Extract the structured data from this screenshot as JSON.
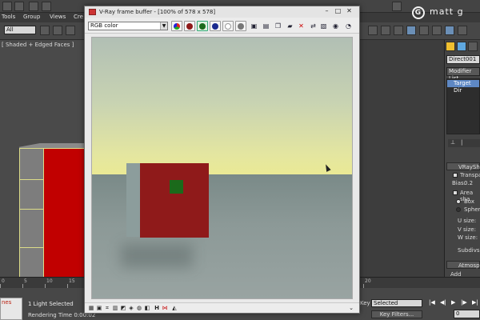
{
  "menubar": {
    "tools": "Tools",
    "group": "Group",
    "views": "Views",
    "create_partial": "Cre"
  },
  "toolbar": {
    "selection_filter": "All"
  },
  "viewport": {
    "label": "[ Shaded + Edged Faces ]"
  },
  "logo": {
    "text": "matt g",
    "mark": "G"
  },
  "command_panel": {
    "object_name": "Direct001",
    "modifier_list": "Modifier List",
    "stack_item": "Target Dir",
    "rollout_title": "VRayShac",
    "transparent_label": "Transpar",
    "bias_label": "Bias:",
    "bias_value": "0.2",
    "area_shadow_label": "Area sha",
    "box_label": "Box",
    "sphere_label": "Sphere",
    "usize_label": "U size:",
    "vsize_label": "V size:",
    "wsize_label": "W size:",
    "subdivs_label": "Subdivs:",
    "atmos_title": "Atmosphe",
    "add_label": "Add"
  },
  "timeline": {
    "ticks": [
      "0",
      "5",
      "10",
      "15",
      "20"
    ]
  },
  "status": {
    "light_selected": "1 Light Selected",
    "rendering_time": "Rendering Time 0:00:02",
    "selected_dropdown": "Selected",
    "key_label": "Key",
    "key_filters": "Key Filters...",
    "frame_value": "0",
    "left_box_text": "nes"
  },
  "vfb": {
    "title": "V-Ray frame buffer - [100% of 578 x 578]",
    "channel": "RGB color",
    "colors": {
      "red": "#8f1a1a",
      "green": "#1b6a1b",
      "blue": "#1a2a8f"
    }
  }
}
